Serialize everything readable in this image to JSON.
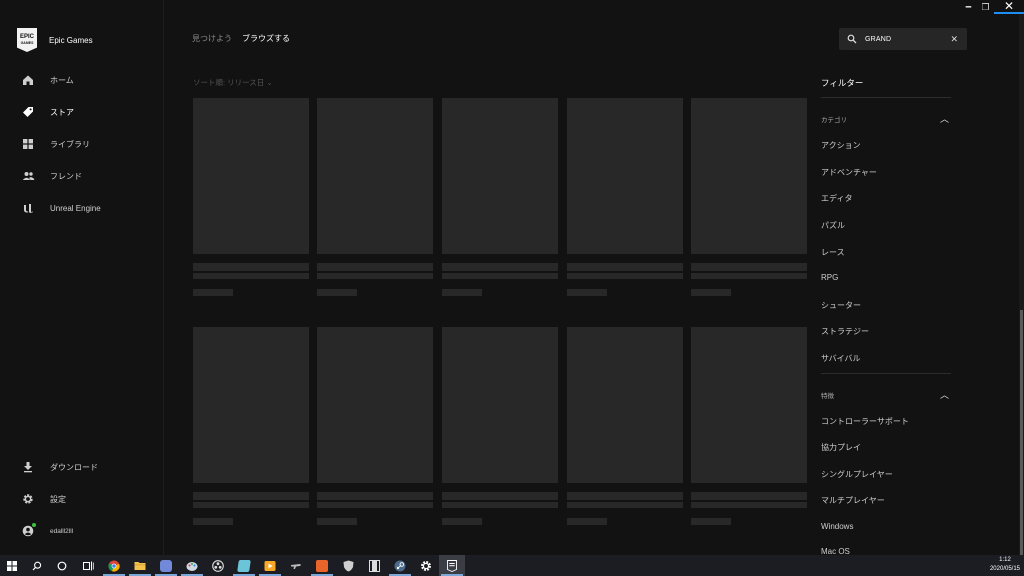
{
  "window": {
    "minimize": "━",
    "restore": "❐",
    "close": "✕"
  },
  "brand": {
    "logo_line1": "EPIC",
    "logo_line2": "GAMES",
    "name": "Epic Games"
  },
  "nav": {
    "home": "ホーム",
    "store": "ストア",
    "library": "ライブラリ",
    "friends": "フレンド",
    "unreal": "Unreal Engine",
    "downloads": "ダウンロード",
    "settings": "設定",
    "user": "edalll2lll"
  },
  "tabs": {
    "discover": "見つけよう",
    "browse": "ブラウズする"
  },
  "search": {
    "value": "GRAND",
    "clear": "✕"
  },
  "sort": {
    "label": "ソート順: リリース日 ⌄"
  },
  "filter": {
    "title": "フィルター",
    "category_title": "カテゴリ",
    "categories": [
      "アクション",
      "アドベンチャー",
      "エディタ",
      "パズル",
      "レース",
      "RPG",
      "シューター",
      "ストラテジー",
      "サバイバル"
    ],
    "feature_title": "特徴",
    "features": [
      "コントローラーサポート",
      "協力プレイ",
      "シングルプレイヤー",
      "マルチプレイヤー",
      "Windows",
      "Mac OS"
    ]
  },
  "clock": {
    "time": "1:12",
    "date": "2020/05/15"
  },
  "colors": {
    "accent": "#1e8ef0",
    "background": "#121212",
    "placeholder": "#282828"
  }
}
